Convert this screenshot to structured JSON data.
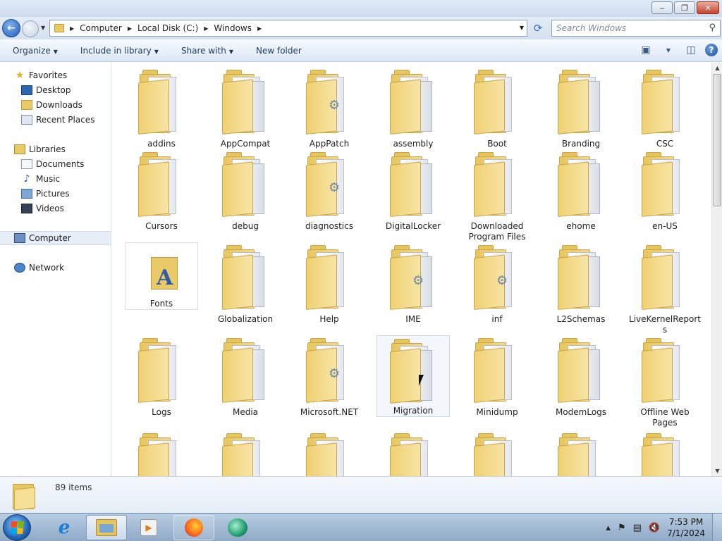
{
  "window": {
    "controls": {
      "minimize": "‒",
      "maximize": "❐",
      "close": "✕"
    }
  },
  "address": {
    "crumbs": [
      "Computer",
      "Local Disk (C:)",
      "Windows"
    ],
    "search_placeholder": "Search Windows"
  },
  "toolbar": {
    "organize": "Organize",
    "include_in_library": "Include in library",
    "share_with": "Share with",
    "new_folder": "New folder"
  },
  "nav": {
    "favorites": "Favorites",
    "desktop": "Desktop",
    "downloads": "Downloads",
    "recent_places": "Recent Places",
    "libraries": "Libraries",
    "documents": "Documents",
    "music": "Music",
    "pictures": "Pictures",
    "videos": "Videos",
    "computer": "Computer",
    "network": "Network"
  },
  "folders": [
    "addins",
    "AppCompat",
    "AppPatch",
    "assembly",
    "Boot",
    "Branding",
    "CSC",
    "Cursors",
    "debug",
    "diagnostics",
    "DigitalLocker",
    "Downloaded Program Files",
    "ehome",
    "en-US",
    "Fonts",
    "Globalization",
    "Help",
    "IME",
    "inf",
    "L2Schemas",
    "LiveKernelReports",
    "Logs",
    "Media",
    "Microsoft.NET",
    "Migration",
    "Minidump",
    "ModemLogs",
    "Offline Web Pages"
  ],
  "selected_folder": "Migration",
  "details": {
    "item_count": "89 items"
  },
  "taskbar": {
    "time": "7:53 PM",
    "date": "7/1/2024"
  }
}
